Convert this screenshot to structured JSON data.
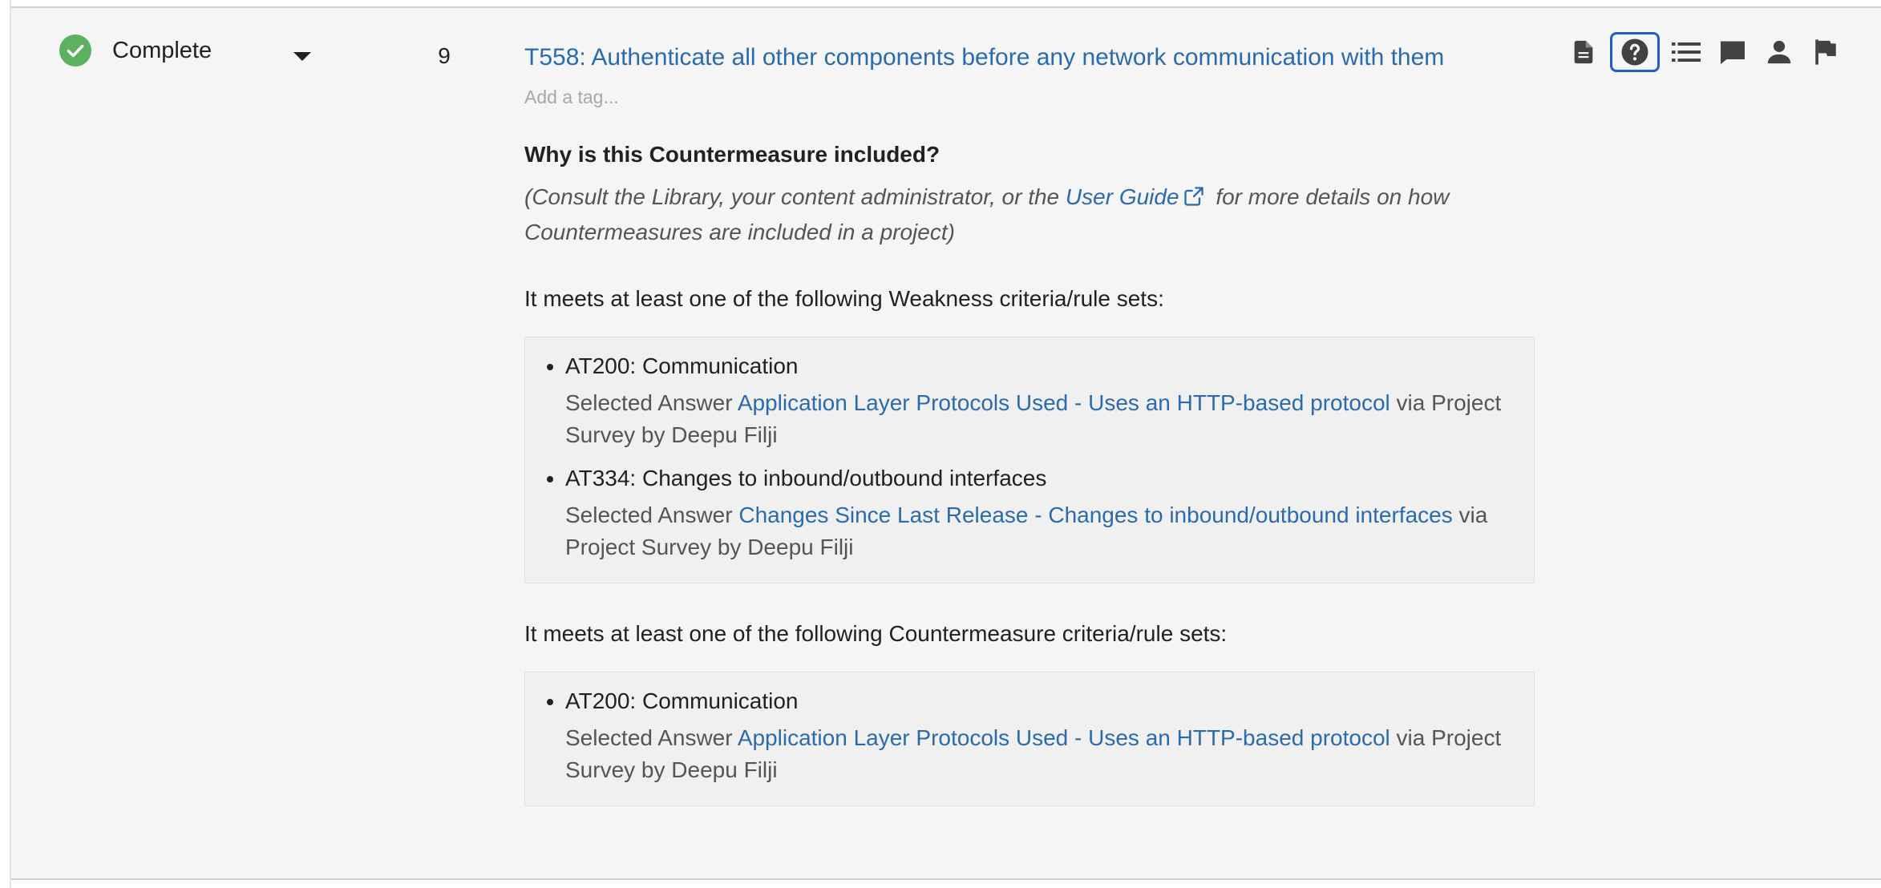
{
  "row": {
    "status": {
      "label": "Complete",
      "icon": "check-circle-icon",
      "color": "#5cb05f"
    },
    "priority": "9",
    "title": "T558: Authenticate all other components before any network communication with them",
    "tag_placeholder": "Add a tag...",
    "toolbar": {
      "icons": [
        "document-icon",
        "help-circle-icon",
        "list-icon",
        "comment-icon",
        "person-icon",
        "flag-icon"
      ]
    },
    "why": {
      "heading": "Why is this Countermeasure included?",
      "consult_before": "(Consult the Library, your content administrator, or the ",
      "consult_link": "User Guide",
      "consult_after": " for more details on how Countermeasures are included in a project)"
    },
    "weakness": {
      "intro": "It meets at least one of the following Weakness criteria/rule sets:",
      "items": [
        {
          "name": "AT200: Communication",
          "prefix": "Selected Answer ",
          "link": "Application Layer Protocols Used - Uses an HTTP-based protocol",
          "suffix": " via Project Survey by Deepu Filji"
        },
        {
          "name": "AT334: Changes to inbound/outbound interfaces",
          "prefix": "Selected Answer ",
          "link": "Changes Since Last Release - Changes to inbound/outbound interfaces",
          "suffix": " via Project Survey by Deepu Filji"
        }
      ]
    },
    "countermeasure": {
      "intro": "It meets at least one of the following Countermeasure criteria/rule sets:",
      "items": [
        {
          "name": "AT200: Communication",
          "prefix": "Selected Answer ",
          "link": "Application Layer Protocols Used - Uses an HTTP-based protocol",
          "suffix": " via Project Survey by Deepu Filji"
        }
      ]
    },
    "colors": {
      "link": "#2a6bb0",
      "focus_ring": "#1f5fc9",
      "icon": "#424242"
    }
  }
}
